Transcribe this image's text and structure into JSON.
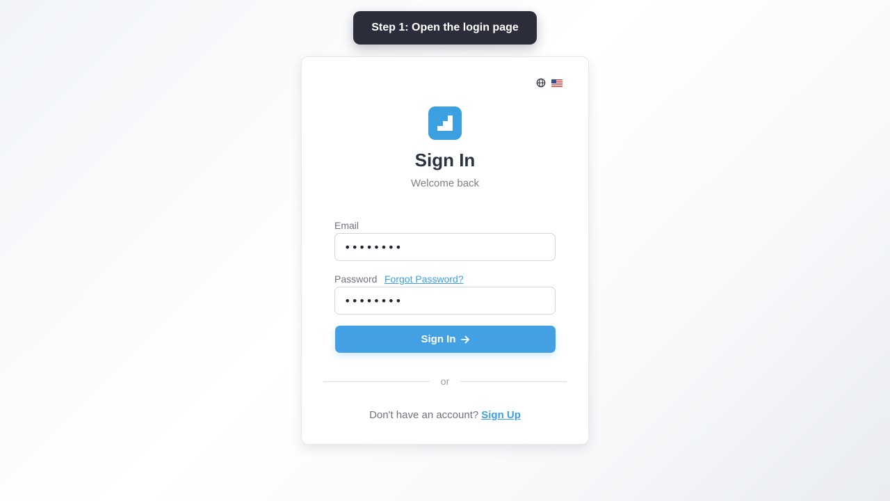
{
  "banner": {
    "text": "Step 1: Open the login page"
  },
  "language": {
    "globe_icon": "globe-icon",
    "flag_icon": "us-flag-icon"
  },
  "logo": {
    "icon": "stairs-logo-icon",
    "color": "#3c9fe0"
  },
  "header": {
    "title": "Sign In",
    "subtitle": "Welcome back"
  },
  "form": {
    "email_label": "Email",
    "email_value": "••••••••",
    "password_label": "Password",
    "forgot_link": "Forgot Password?",
    "password_value": "••••••••",
    "submit_label": "Sign In",
    "submit_icon": "arrow-right-icon"
  },
  "divider": {
    "text": "or"
  },
  "footer": {
    "prompt": "Don't have an account?",
    "signup_link": "Sign Up"
  },
  "colors": {
    "accent": "#43a1e3",
    "banner_bg": "#2b2d3a",
    "title": "#2b3340"
  }
}
